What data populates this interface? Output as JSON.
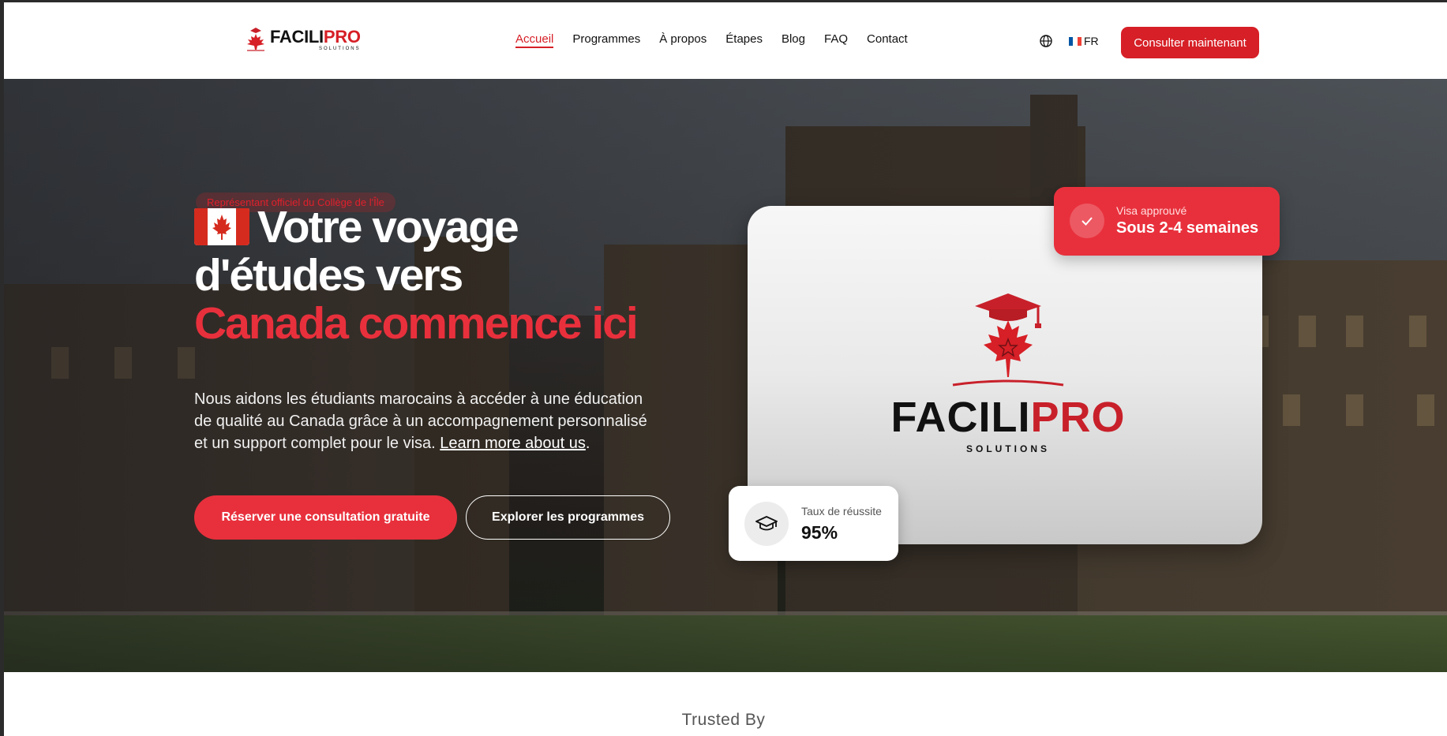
{
  "brand": {
    "name_part1": "FACILI",
    "name_part2": "PRO",
    "subtitle": "SOLUTIONS"
  },
  "nav": {
    "items": [
      {
        "label": "Accueil",
        "active": true
      },
      {
        "label": "Programmes",
        "active": false
      },
      {
        "label": "À propos",
        "active": false
      },
      {
        "label": "Étapes",
        "active": false
      },
      {
        "label": "Blog",
        "active": false
      },
      {
        "label": "FAQ",
        "active": false
      },
      {
        "label": "Contact",
        "active": false
      }
    ],
    "language": "FR",
    "cta": "Consulter maintenant"
  },
  "hero": {
    "badge": "Représentant officiel du Collège de l'Île",
    "title_line1": "Votre voyage",
    "title_line2": "d'études vers",
    "title_highlight": "Canada commence ici",
    "description": "Nous aidons les étudiants marocains à accéder à une éducation de qualité au Canada grâce à un accompagnement personnalisé et un support complet pour le visa.",
    "learn_more": "Learn more about us",
    "primary_button": "Réserver une consultation gratuite",
    "secondary_button": "Explorer les programmes"
  },
  "visa_card": {
    "label": "Visa approuvé",
    "value": "Sous 2-4 semaines"
  },
  "rate_card": {
    "label": "Taux de réussite",
    "value": "95%"
  },
  "trusted": {
    "heading": "Trusted By"
  },
  "colors": {
    "accent": "#e8303c",
    "brand_red": "#d61f26"
  },
  "icons": {
    "globe": "globe-icon",
    "check": "check-icon",
    "graduation": "graduation-cap-icon",
    "flag_canada": "canada-flag-icon",
    "flag_france": "france-flag-icon"
  }
}
